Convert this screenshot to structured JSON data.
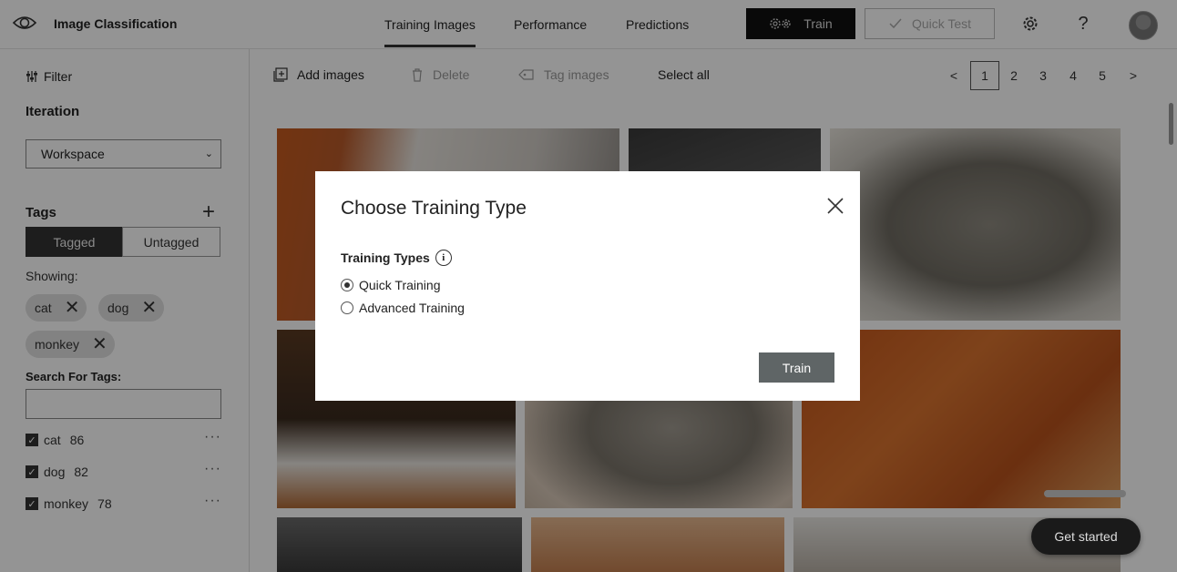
{
  "header": {
    "app_title": "Image Classification",
    "tabs": [
      {
        "label": "Training Images",
        "active": true
      },
      {
        "label": "Performance",
        "active": false
      },
      {
        "label": "Predictions",
        "active": false
      }
    ],
    "train_label": "Train",
    "quick_test_label": "Quick Test",
    "help_glyph": "?"
  },
  "sidebar": {
    "filter_label": "Filter",
    "iteration_heading": "Iteration",
    "iteration_value": "Workspace",
    "tags_heading": "Tags",
    "segment": {
      "tagged": "Tagged",
      "untagged": "Untagged"
    },
    "showing_label": "Showing:",
    "chips": [
      "cat",
      "dog",
      "monkey"
    ],
    "search_label": "Search For Tags:",
    "search_value": "",
    "tag_list": [
      {
        "name": "cat",
        "count": "86",
        "checked": true
      },
      {
        "name": "dog",
        "count": "82",
        "checked": true
      },
      {
        "name": "monkey",
        "count": "78",
        "checked": true
      }
    ]
  },
  "toolbar": {
    "add_images": "Add images",
    "delete": "Delete",
    "tag_images": "Tag images",
    "select_all": "Select all"
  },
  "pagination": {
    "prev": "<",
    "pages": [
      "1",
      "2",
      "3",
      "4",
      "5"
    ],
    "current": "1",
    "next": ">"
  },
  "modal": {
    "title": "Choose Training Type",
    "types_label": "Training Types",
    "info_glyph": "i",
    "options": [
      {
        "label": "Quick Training",
        "selected": true
      },
      {
        "label": "Advanced Training",
        "selected": false
      }
    ],
    "train_button": "Train"
  },
  "get_started": "Get started",
  "colors": {
    "accent_dark": "#111111",
    "modal_button": "#5f6566",
    "overlay": "rgba(0,0,0,0.42)"
  }
}
